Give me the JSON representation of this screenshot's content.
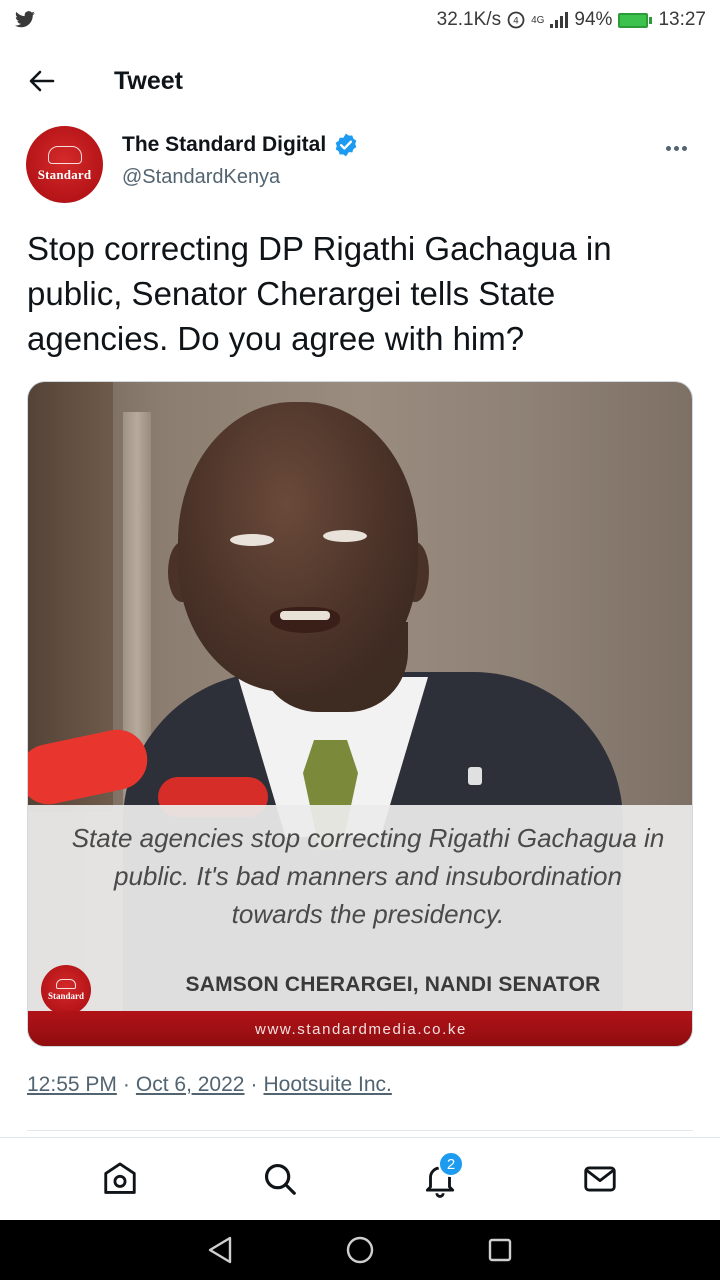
{
  "status_bar": {
    "net_speed": "32.1K/s",
    "network": "4G",
    "battery": "94%",
    "time": "13:27"
  },
  "header": {
    "title": "Tweet"
  },
  "author": {
    "name": "The Standard Digital",
    "handle": "@StandardKenya",
    "avatar_text": "Standard",
    "verified": true
  },
  "tweet": {
    "text": "Stop correcting DP Rigathi Gachagua in public, Senator Cherargei tells State agencies. Do you agree with him?"
  },
  "media": {
    "quote": "State agencies stop correcting Rigathi Gachagua in public. It's bad manners and insubordination towards the presidency.",
    "quote_author": "SAMSON CHERARGEI, NANDI SENATOR",
    "logo_text": "Standard",
    "site_url": "www.standardmedia.co.ke"
  },
  "meta": {
    "time": "12:55 PM",
    "separator": "·",
    "date": "Oct 6, 2022",
    "source": "Hootsuite Inc."
  },
  "bottom_nav": {
    "notifications_badge": "2"
  },
  "colors": {
    "brand_red": "#b51418",
    "twitter_blue": "#1d9bf0",
    "verified_blue": "#1d9bf0"
  }
}
